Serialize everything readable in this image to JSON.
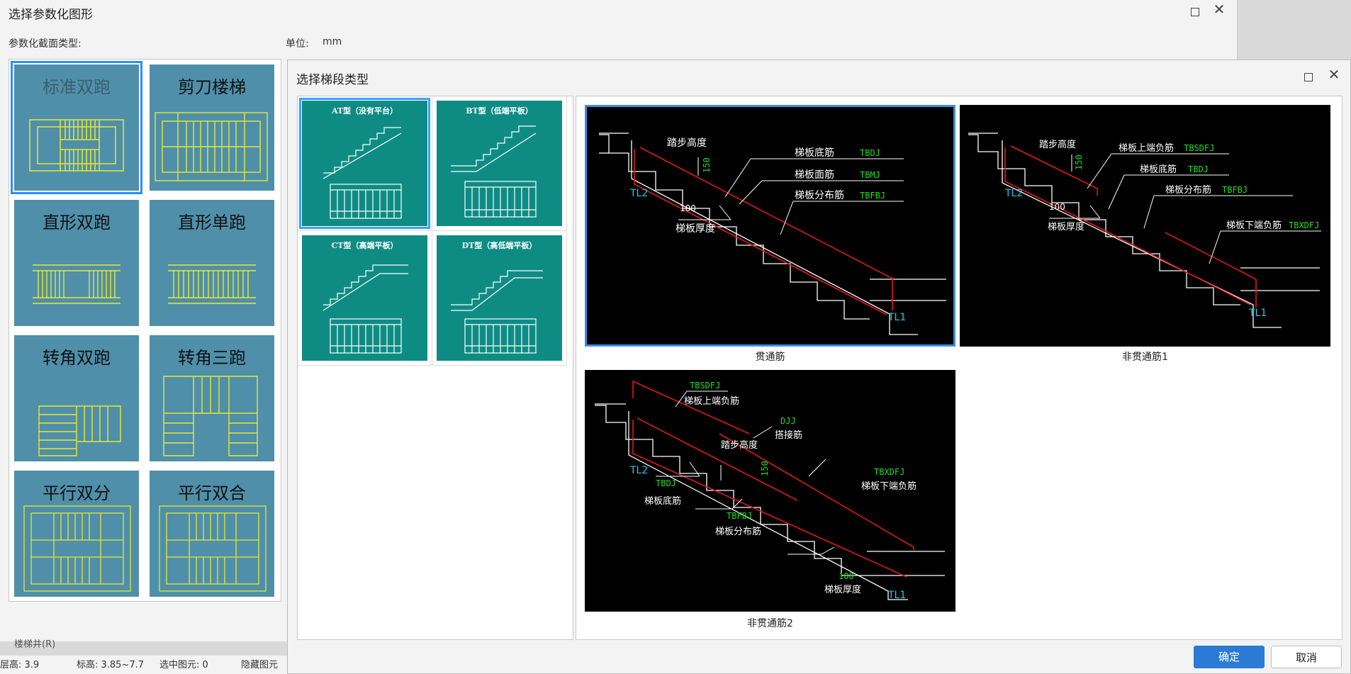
{
  "bg_dialog": {
    "title": "选择参数化图形",
    "section_type_label": "参数化截面类型:",
    "unit_label": "单位:",
    "unit_value": "mm",
    "shapes": [
      {
        "label": "标准双跑"
      },
      {
        "label": "剪刀楼梯"
      },
      {
        "label": "直形双跑"
      },
      {
        "label": "直形单跑"
      },
      {
        "label": "转角双跑"
      },
      {
        "label": "转角三跑"
      },
      {
        "label": "平行双分"
      },
      {
        "label": "平行双合"
      }
    ]
  },
  "status_bar": {
    "tab": "楼梯井(R)",
    "floor_height": "层高:  3.9",
    "elevation": "标高:  3.85~7.7",
    "selected": "选中图元: 0",
    "hidden": "隐藏图元"
  },
  "seg_dialog": {
    "title": "选择梯段类型",
    "types": [
      {
        "caption": "AT型（没有平台）"
      },
      {
        "caption": "BT型（低端平板）"
      },
      {
        "caption": "CT型（高端平板）"
      },
      {
        "caption": "DT型（高低端平板）"
      }
    ],
    "previews": [
      {
        "caption": "贯通筋",
        "labels": {
          "tread_height": "踏步高度",
          "dim_150": "150",
          "bottom_bar": "梯板底筋",
          "bottom_code": "TBDJ",
          "top_bar": "梯板面筋",
          "top_code": "TBMJ",
          "dist_bar": "梯板分布筋",
          "dist_code": "TBFBJ",
          "thick_val": "100",
          "thickness": "梯板厚度",
          "tl2": "TL2",
          "tl1": "TL1"
        }
      },
      {
        "caption": "非贯通筋1",
        "labels": {
          "tread_height": "踏步高度",
          "dim_150": "150",
          "upper_neg": "梯板上端负筋",
          "upper_code": "TBSDFJ",
          "bottom_bar": "梯板底筋",
          "bottom_code": "TBDJ",
          "dist_bar": "梯板分布筋",
          "dist_code": "TBFBJ",
          "lower_neg": "梯板下端负筋",
          "lower_code": "TBXDFJ",
          "thick_val": "100",
          "thickness": "梯板厚度",
          "tl2": "TL2",
          "tl1": "TL1"
        }
      },
      {
        "caption": "非贯通筋2",
        "labels": {
          "upper_code": "TBSDFJ",
          "upper_neg": "梯板上端负筋",
          "lap_code": "DJJ",
          "lap_bar": "搭接筋",
          "tread_height": "踏步高度",
          "dim_150": "150",
          "lower_code": "TBXDFJ",
          "lower_neg": "梯板下端负筋",
          "bottom_code": "TBDJ",
          "bottom_bar": "梯板底筋",
          "dist_code": "TBFBJ",
          "dist_bar": "梯板分布筋",
          "thick_val": "100",
          "thickness": "梯板厚度",
          "tl2": "TL2",
          "tl1": "TL1"
        }
      }
    ],
    "ok": "确定",
    "cancel": "取消"
  },
  "colors": {
    "shape_tile": "#4f8faa",
    "seg_tile": "#0e8c84",
    "accent": "#2b7bd6",
    "rebar": "#e01818",
    "code_green": "#22dd22",
    "beam_cyan": "#28c8e8"
  }
}
